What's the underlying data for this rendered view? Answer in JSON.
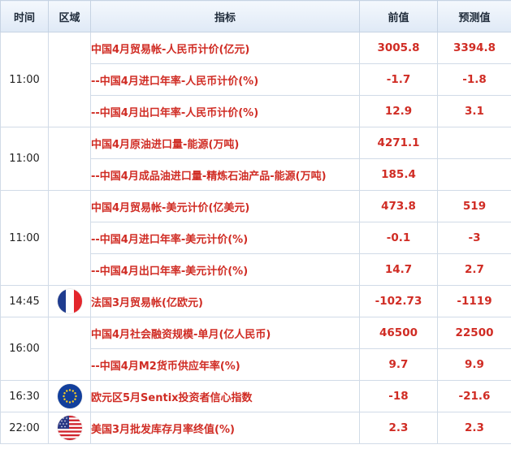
{
  "header": {
    "time": "时间",
    "region": "区域",
    "indicator": "指标",
    "previous": "前值",
    "forecast": "预测值"
  },
  "groups": [
    {
      "time": "11:00",
      "flag_icon": "",
      "rows": [
        {
          "indicator": "中国4月贸易帐-人民币计价(亿元)",
          "previous": "3005.8",
          "forecast": "3394.8"
        },
        {
          "indicator": "--中国4月进口年率-人民币计价(%)",
          "previous": "-1.7",
          "forecast": "-1.8"
        },
        {
          "indicator": "--中国4月出口年率-人民币计价(%)",
          "previous": "12.9",
          "forecast": "3.1"
        }
      ]
    },
    {
      "time": "11:00",
      "flag_icon": "",
      "rows": [
        {
          "indicator": "中国4月原油进口量-能源(万吨)",
          "previous": "4271.1",
          "forecast": ""
        },
        {
          "indicator": "--中国4月成品油进口量-精炼石油产品-能源(万吨)",
          "previous": "185.4",
          "forecast": ""
        }
      ]
    },
    {
      "time": "11:00",
      "flag_icon": "",
      "rows": [
        {
          "indicator": "中国4月贸易帐-美元计价(亿美元)",
          "previous": "473.8",
          "forecast": "519"
        },
        {
          "indicator": "--中国4月进口年率-美元计价(%)",
          "previous": "-0.1",
          "forecast": "-3"
        },
        {
          "indicator": "--中国4月出口年率-美元计价(%)",
          "previous": "14.7",
          "forecast": "2.7"
        }
      ]
    },
    {
      "time": "14:45",
      "flag_icon": "france-flag-icon",
      "rows": [
        {
          "indicator": "法国3月贸易帐(亿欧元)",
          "previous": "-102.73",
          "forecast": "-1119"
        }
      ]
    },
    {
      "time": "16:00",
      "flag_icon": "",
      "rows": [
        {
          "indicator": "中国4月社会融资规模-单月(亿人民币)",
          "previous": "46500",
          "forecast": "22500"
        },
        {
          "indicator": "--中国4月M2货币供应年率(%)",
          "previous": "9.7",
          "forecast": "9.9"
        }
      ]
    },
    {
      "time": "16:30",
      "flag_icon": "eurozone-flag-icon",
      "rows": [
        {
          "indicator": "欧元区5月Sentix投资者信心指数",
          "previous": "-18",
          "forecast": "-21.6"
        }
      ]
    },
    {
      "time": "22:00",
      "flag_icon": "usa-flag-icon",
      "rows": [
        {
          "indicator": "美国3月批发库存月率终值(%)",
          "previous": "2.3",
          "forecast": "2.3"
        }
      ]
    }
  ]
}
